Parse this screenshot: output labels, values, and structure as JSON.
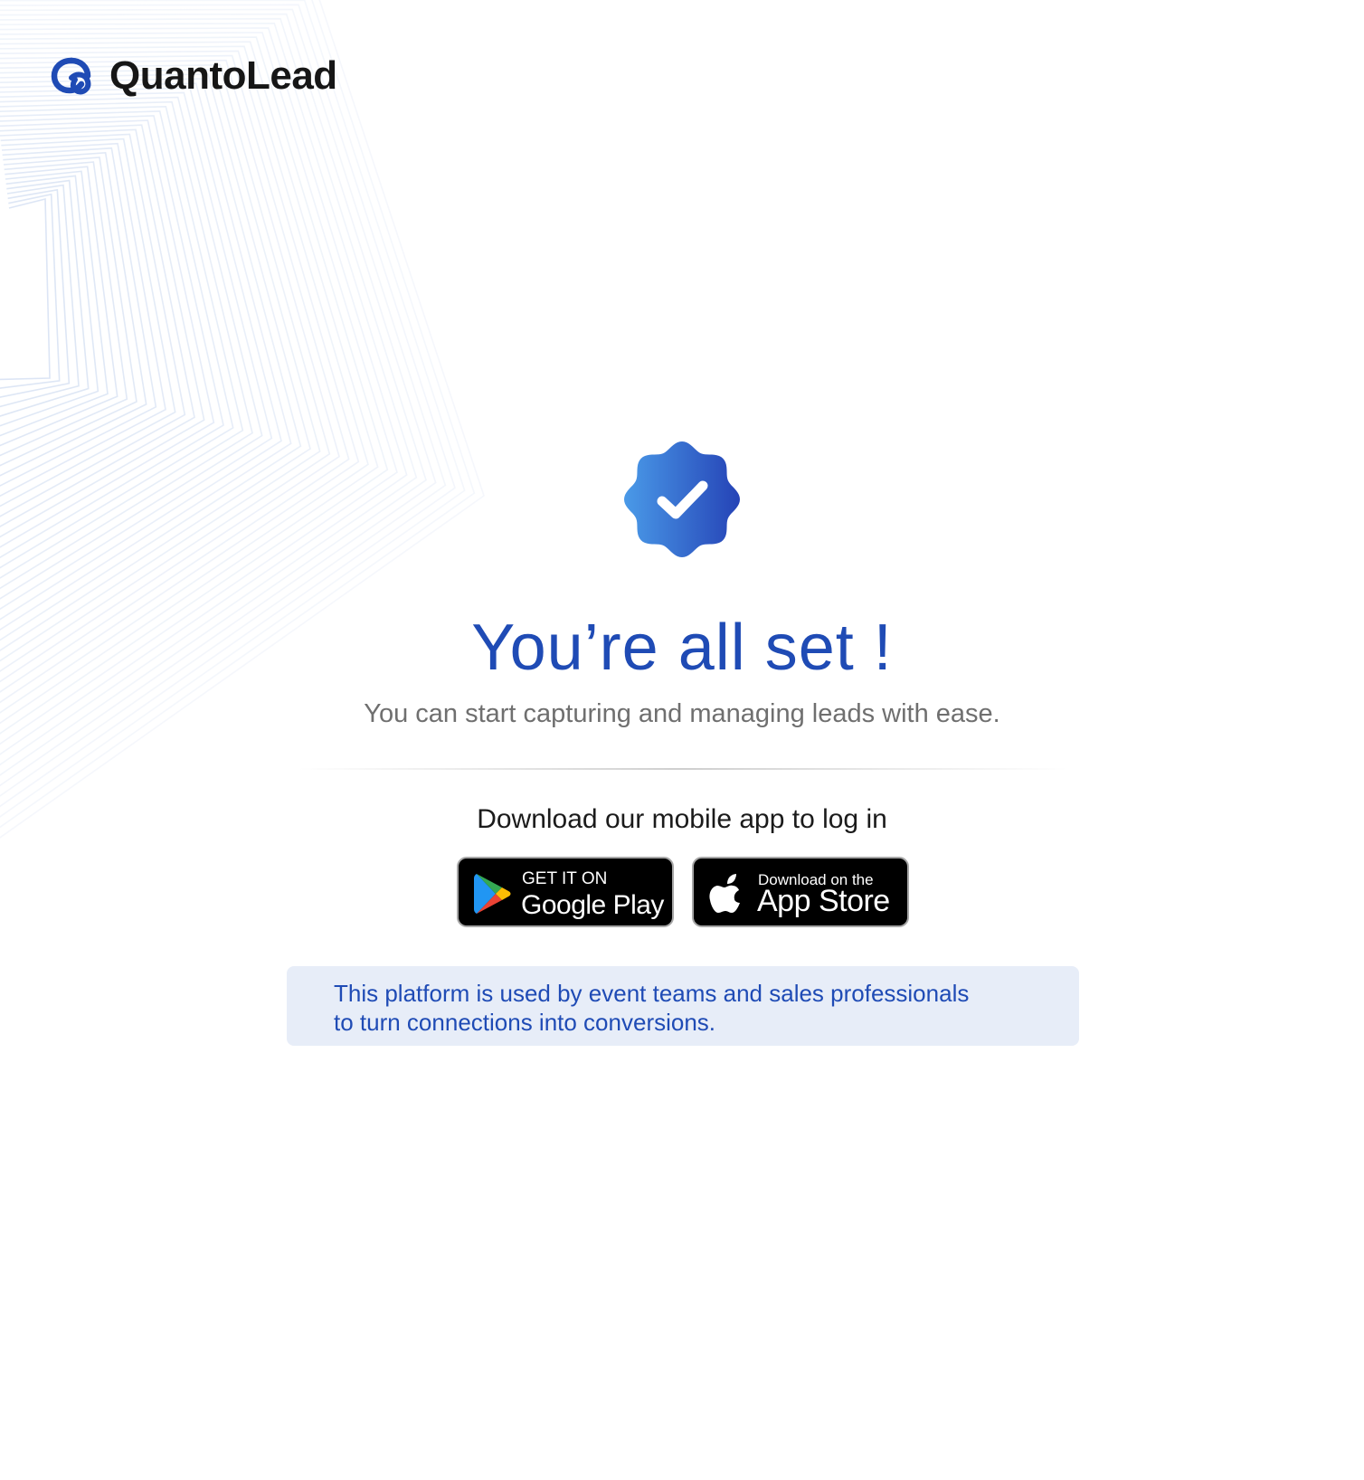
{
  "brand": {
    "name": "QuantoLead",
    "logo_icon": "quantolead-q-icon",
    "color": "#1f4bb5"
  },
  "status": {
    "icon": "verified-check-badge-icon",
    "title": "You’re all set !",
    "subtitle": "You can start capturing and managing leads with ease."
  },
  "download": {
    "heading": "Download our mobile app to log in",
    "google_play": {
      "icon": "google-play-icon",
      "small_label": "GET IT ON",
      "big_label": "Google Play"
    },
    "app_store": {
      "icon": "apple-icon",
      "small_label": "Download on the",
      "big_label": "App Store"
    }
  },
  "info": {
    "line1": "This platform is used by event teams and sales professionals",
    "line2": "to turn connections into conversions."
  },
  "colors": {
    "accent": "#1f4bb5",
    "badge_gradient_start": "#4a90e8",
    "badge_gradient_end": "#2748b8",
    "info_background": "#e7edf8"
  }
}
